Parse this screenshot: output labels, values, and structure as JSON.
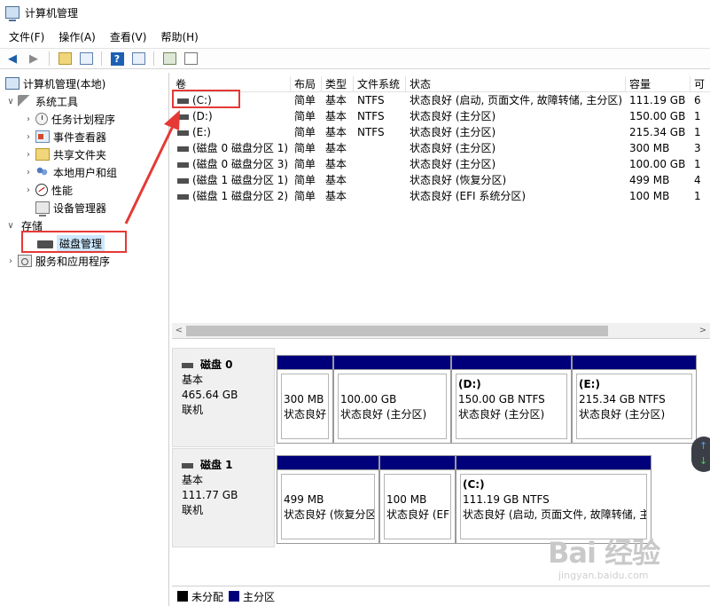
{
  "window": {
    "title": "计算机管理"
  },
  "menu": [
    "文件(F)",
    "操作(A)",
    "查看(V)",
    "帮助(H)"
  ],
  "toolbar": {
    "icons": [
      "back-arrow-icon",
      "forward-arrow-icon",
      "folder-up-icon",
      "console-tree-icon",
      "help-icon",
      "properties-icon",
      "connect-icon",
      "disk-view-icon"
    ],
    "help_glyph": "?"
  },
  "tree": {
    "root": "计算机管理(本地)",
    "system_tools": "系统工具",
    "task_scheduler": "任务计划程序",
    "event_viewer": "事件查看器",
    "shared_folders": "共享文件夹",
    "local_users": "本地用户和组",
    "performance": "性能",
    "device_manager": "设备管理器",
    "storage": "存储",
    "disk_management": "磁盘管理",
    "services": "服务和应用程序"
  },
  "volume_list": {
    "columns": [
      "卷",
      "布局",
      "类型",
      "文件系统",
      "状态",
      "容量",
      "可"
    ],
    "rows": [
      {
        "vol": "(C:)",
        "layout": "简单",
        "type": "基本",
        "fs": "NTFS",
        "status": "状态良好 (启动, 页面文件, 故障转储, 主分区)",
        "capacity": "111.19 GB",
        "free": "6"
      },
      {
        "vol": "(D:)",
        "layout": "简单",
        "type": "基本",
        "fs": "NTFS",
        "status": "状态良好 (主分区)",
        "capacity": "150.00 GB",
        "free": "1"
      },
      {
        "vol": "(E:)",
        "layout": "简单",
        "type": "基本",
        "fs": "NTFS",
        "status": "状态良好 (主分区)",
        "capacity": "215.34 GB",
        "free": "1"
      },
      {
        "vol": "(磁盘 0 磁盘分区 1)",
        "layout": "简单",
        "type": "基本",
        "fs": "",
        "status": "状态良好 (主分区)",
        "capacity": "300 MB",
        "free": "3"
      },
      {
        "vol": "(磁盘 0 磁盘分区 3)",
        "layout": "简单",
        "type": "基本",
        "fs": "",
        "status": "状态良好 (主分区)",
        "capacity": "100.00 GB",
        "free": "1"
      },
      {
        "vol": "(磁盘 1 磁盘分区 1)",
        "layout": "简单",
        "type": "基本",
        "fs": "",
        "status": "状态良好 (恢复分区)",
        "capacity": "499 MB",
        "free": "4"
      },
      {
        "vol": "(磁盘 1 磁盘分区 2)",
        "layout": "简单",
        "type": "基本",
        "fs": "",
        "status": "状态良好 (EFI 系统分区)",
        "capacity": "100 MB",
        "free": "1"
      }
    ],
    "scroll_left": "<",
    "scroll_right": ">"
  },
  "disks": [
    {
      "name": "磁盘 0",
      "type": "基本",
      "size": "465.64 GB",
      "state": "联机",
      "partitions": [
        {
          "name": "",
          "size": "300 MB",
          "status": "状态良好"
        },
        {
          "name": "",
          "size": "100.00 GB",
          "status": "状态良好 (主分区)"
        },
        {
          "name": "(D:)",
          "size": "150.00 GB NTFS",
          "status": "状态良好 (主分区)"
        },
        {
          "name": "(E:)",
          "size": "215.34 GB NTFS",
          "status": "状态良好 (主分区)"
        }
      ]
    },
    {
      "name": "磁盘 1",
      "type": "基本",
      "size": "111.77 GB",
      "state": "联机",
      "partitions": [
        {
          "name": "",
          "size": "499 MB",
          "status": "状态良好 (恢复分区"
        },
        {
          "name": "",
          "size": "100 MB",
          "status": "状态良好 (EF"
        },
        {
          "name": "(C:)",
          "size": "111.19 GB NTFS",
          "status": "状态良好 (启动, 页面文件, 故障转储, 主"
        }
      ]
    }
  ],
  "legend": {
    "unallocated": "未分配",
    "primary": "主分区",
    "unallocated_color": "#000000",
    "primary_color": "#00007b"
  },
  "colors": {
    "highlight": "#e53935",
    "selection": "#cde8ff",
    "partition_bar": "#00007b"
  },
  "scroll_widget": {
    "up": "↑",
    "down": "↓"
  },
  "watermark": {
    "main": "Bai 经验",
    "sub": "jingyan.baidu.com"
  }
}
